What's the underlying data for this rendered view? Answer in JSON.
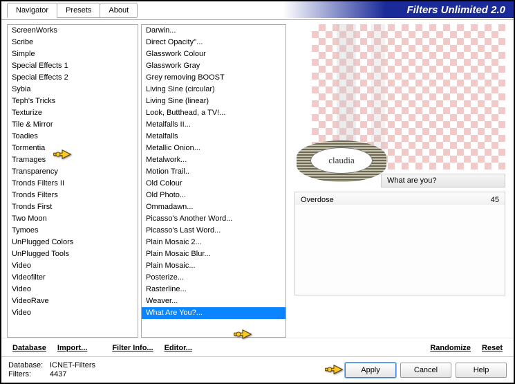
{
  "header": {
    "title": "Filters Unlimited 2.0"
  },
  "tabs": [
    {
      "label": "Navigator",
      "active": true
    },
    {
      "label": "Presets",
      "active": false
    },
    {
      "label": "About",
      "active": false
    }
  ],
  "categories": [
    "ScreenWorks",
    "Scribe",
    "Simple",
    "Special Effects 1",
    "Special Effects 2",
    "Sybia",
    "Teph's Tricks",
    "Texturize",
    "Tile & Mirror",
    "Toadies",
    "Tormentia",
    "Tramages",
    "Transparency",
    "Tronds Filters II",
    "Tronds Filters",
    "Tronds First",
    "Two Moon",
    "Tymoes",
    "UnPlugged Colors",
    "UnPlugged Tools",
    "Video",
    "Videofilter",
    "Video",
    "VideoRave",
    "Video"
  ],
  "filters": [
    "Darwin...",
    "Direct Opacity''...",
    "Glasswork Colour",
    "Glasswork Gray",
    "Grey removing BOOST",
    "Living Sine (circular)",
    "Living Sine (linear)",
    "Look, Butthead, a TV!...",
    "Metalfalls II...",
    "Metalfalls",
    "Metallic Onion...",
    "Metalwork...",
    "Motion Trail..",
    "Old Colour",
    "Old Photo...",
    "Ommadawn...",
    "Picasso's Another Word...",
    "Picasso's Last Word...",
    "Plain Mosaic 2...",
    "Plain Mosaic Blur...",
    "Plain Mosaic...",
    "Posterize...",
    "Rasterline...",
    "Weaver...",
    "What Are You?..."
  ],
  "selected_filter_index": 24,
  "preview": {
    "filter_name": "What are you?",
    "badge_text": "claudia"
  },
  "params": [
    {
      "name": "Overdose",
      "value": "45"
    }
  ],
  "toolbar": {
    "database": "Database",
    "import": "Import...",
    "filter_info": "Filter Info...",
    "editor": "Editor...",
    "randomize": "Randomize",
    "reset": "Reset"
  },
  "footer": {
    "db_label": "Database:",
    "db_value": "ICNET-Filters",
    "filters_label": "Filters:",
    "filters_value": "4437",
    "apply": "Apply",
    "cancel": "Cancel",
    "help": "Help"
  }
}
